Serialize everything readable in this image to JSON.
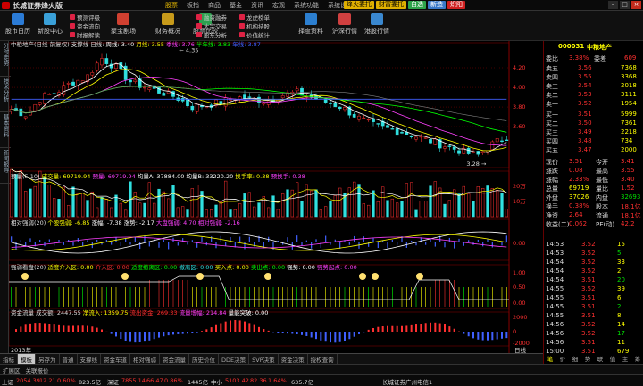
{
  "app": {
    "title": "长城证券烽火版",
    "menu": [
      "股票",
      "板指",
      "商品",
      "基金",
      "资讯",
      "宏观",
      "系统功能",
      "系统设置"
    ],
    "menu_active": 0,
    "topright": [
      "烽火委托",
      "财富委托",
      "自选",
      "新造",
      "炽阳"
    ],
    "toolbar": {
      "big": [
        "股市日历",
        "新股中心",
        "聚宝剧场",
        "财务概况",
        "股票比较",
        "择度资料",
        "沪深行情",
        "港股行情"
      ],
      "small": [
        "预测评级",
        "资金流向",
        "财报解读",
        "融资融券",
        "大宗交易",
        "股东分析",
        "龙虎榜单",
        "机构持股",
        "价值统计"
      ]
    }
  },
  "sidebar": [
    "分时走势",
    "技术分析",
    "基本资料",
    "新闻报导"
  ],
  "stock": {
    "code": "000031",
    "name": "中粮地产"
  },
  "main_header": {
    "label": "中粮地产(日线 前复权) 支撑线 日线:",
    "ma": [
      {
        "name": "周线",
        "value": "3.40"
      },
      {
        "name": "月线",
        "value": "3.55"
      },
      {
        "name": "季线",
        "value": "3.76"
      },
      {
        "name": "半年线",
        "value": "3.83"
      },
      {
        "name": "年线",
        "value": "3.87"
      }
    ]
  },
  "price_axis": [
    "4.20",
    "4.00",
    "3.80",
    "3.60"
  ],
  "annot": {
    "high": "4.35",
    "low": "3.28"
  },
  "vol_header": {
    "label": "预量(5,10)",
    "items": [
      {
        "name": "成交量",
        "value": "69719.94"
      },
      {
        "name": "预量",
        "value": "69719.94"
      },
      {
        "name": "均量A",
        "value": "37884.00"
      },
      {
        "name": "均量B",
        "value": "33220.20"
      },
      {
        "name": "换手率",
        "value": "0.38"
      },
      {
        "name": "预换手",
        "value": "0.38"
      }
    ]
  },
  "rsi_header": {
    "label": "相对强弱(20)",
    "items": [
      {
        "name": "个股强弱",
        "value": "-6.85"
      },
      {
        "name": "涨幅",
        "value": "-7.38"
      },
      {
        "name": "涨势",
        "value": "-2.17"
      },
      {
        "name": "大盘强弱",
        "value": "4.70"
      },
      {
        "name": "相对强弱",
        "value": "-2.16"
      }
    ]
  },
  "trend_header": {
    "label": "强弱看盘(20)",
    "items": [
      "适度介入区: 0.00",
      "介入区: 0.00",
      "适度撤离区: 0.00",
      "撤离区: 0.00",
      "买入点: 0.00",
      "卖出点: 0.00",
      "强势: 0.00",
      "强势起点: 0.00"
    ]
  },
  "cash_header": {
    "label": "资金流量",
    "items": [
      {
        "name": "成交额",
        "value": "2447.55"
      },
      {
        "name": "净流入",
        "value": "1359.75"
      },
      {
        "name": "流出资金",
        "value": "269.33"
      },
      {
        "name": "流量增幅",
        "value": "214.84"
      },
      {
        "name": "量能突破",
        "value": "0.00"
      }
    ]
  },
  "sub_axes": {
    "vol": [
      "20万",
      "10万"
    ],
    "rsi": [
      "0.00"
    ],
    "trend": [
      "1.00",
      "0.50",
      "0.00"
    ],
    "cash": [
      "2000",
      "0",
      "-2000"
    ]
  },
  "date_label": "2013年",
  "cycle_label": "日线",
  "quote": {
    "wei": [
      {
        "k": "委比",
        "v": "3.38%"
      },
      {
        "k": "委差",
        "v": "609"
      }
    ],
    "sell": [
      {
        "k": "卖五",
        "p": "3.56",
        "v": "7368"
      },
      {
        "k": "卖四",
        "p": "3.55",
        "v": "3368"
      },
      {
        "k": "卖三",
        "p": "3.54",
        "v": "2018"
      },
      {
        "k": "卖二",
        "p": "3.53",
        "v": "3111"
      },
      {
        "k": "卖一",
        "p": "3.52",
        "v": "1954"
      }
    ],
    "buy": [
      {
        "k": "买一",
        "p": "3.51",
        "v": "5999"
      },
      {
        "k": "买二",
        "p": "3.50",
        "v": "7361"
      },
      {
        "k": "买三",
        "p": "3.49",
        "v": "2218"
      },
      {
        "k": "买四",
        "p": "3.48",
        "v": "734"
      },
      {
        "k": "买五",
        "p": "3.47",
        "v": "2000"
      }
    ],
    "stats": [
      {
        "k": "现价",
        "v": "3.51",
        "k2": "今开",
        "v2": "3.41"
      },
      {
        "k": "涨跌",
        "v": "0.08",
        "k2": "最高",
        "v2": "3.55"
      },
      {
        "k": "涨幅",
        "v": "2.33%",
        "k2": "最低",
        "v2": "3.40"
      },
      {
        "k": "总量",
        "v": "69719",
        "k2": "量比",
        "v2": "1.52"
      },
      {
        "k": "外盘",
        "v": "37026",
        "k2": "内盘",
        "v2": "32693"
      },
      {
        "k": "换手",
        "v": "0.38%",
        "k2": "股本",
        "v2": "18.1亿"
      },
      {
        "k": "净资",
        "v": "2.64",
        "k2": "流通",
        "v2": "18.1亿"
      },
      {
        "k": "收益(二)",
        "v": "0.062",
        "k2": "PE(动)",
        "v2": "42.2"
      }
    ],
    "ticks": [
      {
        "t": "14:53",
        "p": "3.52",
        "v": "15"
      },
      {
        "t": "14:53",
        "p": "3.52",
        "v": "5"
      },
      {
        "t": "14:54",
        "p": "3.52",
        "v": "33"
      },
      {
        "t": "14:54",
        "p": "3.52",
        "v": "2"
      },
      {
        "t": "14:54",
        "p": "3.51",
        "v": "20"
      },
      {
        "t": "14:55",
        "p": "3.52",
        "v": "39"
      },
      {
        "t": "14:55",
        "p": "3.51",
        "v": "6"
      },
      {
        "t": "14:55",
        "p": "3.51",
        "v": "2"
      },
      {
        "t": "14:55",
        "p": "3.51",
        "v": "8"
      },
      {
        "t": "14:56",
        "p": "3.52",
        "v": "14"
      },
      {
        "t": "14:56",
        "p": "3.52",
        "v": "17"
      },
      {
        "t": "14:56",
        "p": "3.51",
        "v": "11"
      },
      {
        "t": "15:00",
        "p": "3.51",
        "v": "679"
      }
    ],
    "bottom_tabs": [
      "笔",
      "价",
      "细",
      "势",
      "联",
      "值",
      "主",
      "筹"
    ]
  },
  "bottom_tabs": [
    "指标",
    "模板",
    "另存为",
    "普通",
    "支撑线",
    "资金车道",
    "相对强弱",
    "资金流量",
    "历史价位",
    "DDE决策",
    "SVP决策",
    "资金决策",
    "授权查询"
  ],
  "bottom_active": 1,
  "tabs2": [
    "扩展区",
    "关联报价"
  ],
  "status": {
    "sh_label": "上证",
    "sh": "2054.39",
    "sh_chg": "12.21",
    "sh_pct": "0.60%",
    "sh_amt": "823.5亿",
    "sz_label": "深证",
    "sz": "7855.14",
    "sz_chg": "66.47",
    "sz_pct": "0.86%",
    "sz_amt": "1445亿",
    "zx_label": "中小",
    "zx": "5103.42",
    "zx_chg": "82.36",
    "zx_pct": "1.64%",
    "zx_amt": "635.7亿",
    "broker": "长城证券广州电信1"
  }
}
